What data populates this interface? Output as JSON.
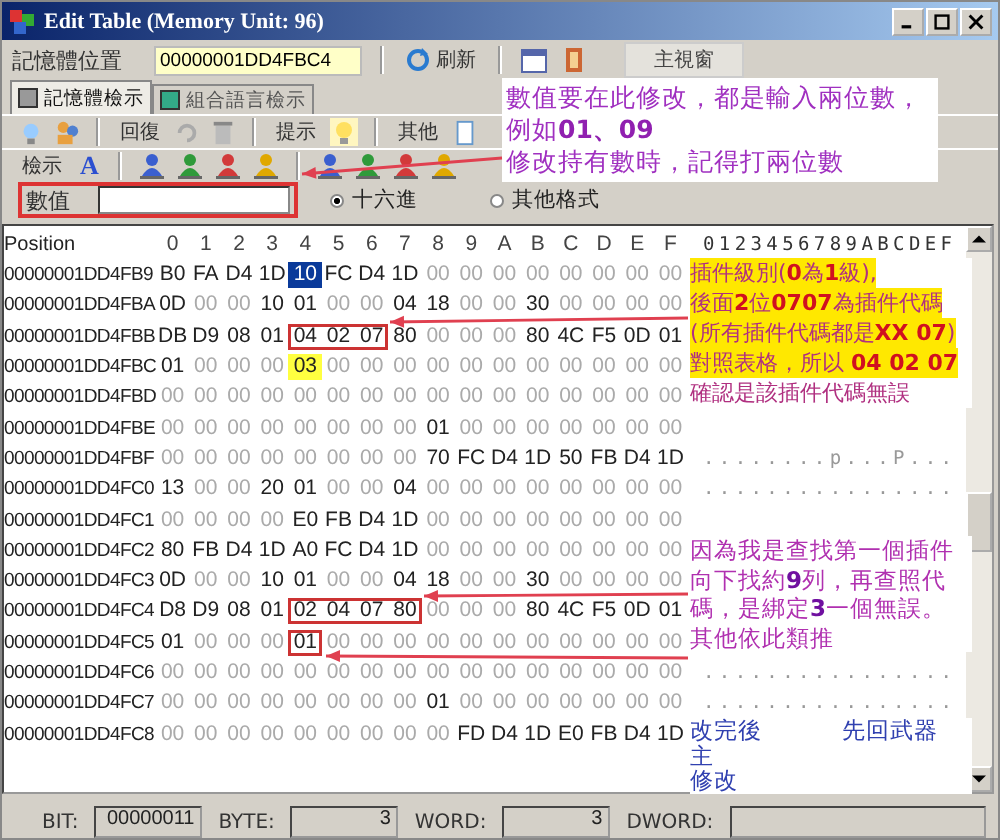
{
  "window": {
    "title": "Edit Table (Memory Unit: 96)"
  },
  "address_bar": {
    "label": "記憶體位置",
    "value": "00000001DD4FBC4",
    "refresh": "刷新",
    "main_window": "主視窗"
  },
  "tabs": [
    {
      "label": "記憶體檢示",
      "selected": true
    },
    {
      "label": "組合語言檢示",
      "selected": false
    }
  ],
  "toolbar": {
    "restore": "回復",
    "hint": "提示",
    "other": "其他",
    "view": "檢示",
    "font_glyph": "A"
  },
  "value_row": {
    "label": "數值",
    "format_options": [
      {
        "label": "十六進",
        "selected": true
      },
      {
        "label": "其他格式",
        "selected": false
      }
    ]
  },
  "grid": {
    "position_header": "Position",
    "columns": [
      "0",
      "1",
      "2",
      "3",
      "4",
      "5",
      "6",
      "7",
      "8",
      "9",
      "A",
      "B",
      "C",
      "D",
      "E",
      "F"
    ],
    "ascii_header": "0123456789ABCDEF",
    "rows": [
      {
        "position": "00000001DD4FB9",
        "segments": [
          {
            "kind": "plain",
            "values": [
              "B0",
              "FA",
              "D4",
              "1D"
            ]
          },
          {
            "kind": "selected",
            "values": [
              "10"
            ]
          },
          {
            "kind": "plain",
            "values": [
              "FC",
              "D4",
              "1D",
              "00",
              "00",
              "00",
              "00",
              "00",
              "00",
              "00",
              "00"
            ]
          }
        ]
      },
      {
        "position": "00000001DD4FBA",
        "segments": [
          {
            "kind": "plain",
            "values": [
              "0D",
              "00",
              "00",
              "10",
              "01",
              "00",
              "00",
              "04",
              "18",
              "00",
              "00",
              "30",
              "00",
              "00",
              "00",
              "00"
            ]
          }
        ]
      },
      {
        "position": "00000001DD4FBB",
        "segments": [
          {
            "kind": "plain",
            "values": [
              "DB",
              "D9",
              "08",
              "01"
            ]
          },
          {
            "kind": "boxed",
            "values": [
              "04",
              "02",
              "07"
            ]
          },
          {
            "kind": "plain",
            "values": [
              "80",
              "00",
              "00",
              "00",
              "80",
              "4C",
              "F5",
              "0D",
              "01"
            ]
          }
        ]
      },
      {
        "position": "00000001DD4FBC",
        "segments": [
          {
            "kind": "plain",
            "values": [
              "01",
              "00",
              "00",
              "00"
            ]
          },
          {
            "kind": "highlighted",
            "values": [
              "03"
            ]
          },
          {
            "kind": "plain",
            "values": [
              "00",
              "00",
              "00",
              "00",
              "00",
              "00",
              "00",
              "00",
              "00",
              "00",
              "00"
            ]
          }
        ]
      },
      {
        "position": "00000001DD4FBD",
        "segments": [
          {
            "kind": "plain",
            "values": [
              "00",
              "00",
              "00",
              "00",
              "00",
              "00",
              "00",
              "00",
              "00",
              "00",
              "00",
              "00",
              "00",
              "00",
              "00",
              "00"
            ]
          }
        ]
      },
      {
        "position": "00000001DD4FBE",
        "segments": [
          {
            "kind": "plain",
            "values": [
              "00",
              "00",
              "00",
              "00",
              "00",
              "00",
              "00",
              "00",
              "01",
              "00",
              "00",
              "00",
              "00",
              "00",
              "00",
              "00"
            ]
          }
        ]
      },
      {
        "position": "00000001DD4FBF",
        "segments": [
          {
            "kind": "plain",
            "values": [
              "00",
              "00",
              "00",
              "00",
              "00",
              "00",
              "00",
              "00",
              "70",
              "FC",
              "D4",
              "1D",
              "50",
              "FB",
              "D4",
              "1D"
            ]
          }
        ],
        "ascii": "........p...P..."
      },
      {
        "position": "00000001DD4FC0",
        "segments": [
          {
            "kind": "plain",
            "values": [
              "13",
              "00",
              "00",
              "20",
              "01",
              "00",
              "00",
              "04",
              "00",
              "00",
              "00",
              "00",
              "00",
              "00",
              "00",
              "00"
            ]
          }
        ],
        "ascii": "................"
      },
      {
        "position": "00000001DD4FC1",
        "segments": [
          {
            "kind": "plain",
            "values": [
              "00",
              "00",
              "00",
              "00",
              "E0",
              "FB",
              "D4",
              "1D",
              "00",
              "00",
              "00",
              "00",
              "00",
              "00",
              "00",
              "00"
            ]
          }
        ]
      },
      {
        "position": "00000001DD4FC2",
        "segments": [
          {
            "kind": "plain",
            "values": [
              "80",
              "FB",
              "D4",
              "1D",
              "A0",
              "FC",
              "D4",
              "1D",
              "00",
              "00",
              "00",
              "00",
              "00",
              "00",
              "00",
              "00"
            ]
          }
        ]
      },
      {
        "position": "00000001DD4FC3",
        "segments": [
          {
            "kind": "plain",
            "values": [
              "0D",
              "00",
              "00",
              "10",
              "01",
              "00",
              "00",
              "04",
              "18",
              "00",
              "00",
              "30",
              "00",
              "00",
              "00",
              "00"
            ]
          }
        ]
      },
      {
        "position": "00000001DD4FC4",
        "segments": [
          {
            "kind": "plain",
            "values": [
              "D8",
              "D9",
              "08",
              "01"
            ]
          },
          {
            "kind": "boxed",
            "values": [
              "02",
              "04",
              "07",
              "80"
            ]
          },
          {
            "kind": "plain",
            "values": [
              "00",
              "00",
              "00",
              "80",
              "4C",
              "F5",
              "0D",
              "01"
            ]
          }
        ]
      },
      {
        "position": "00000001DD4FC5",
        "segments": [
          {
            "kind": "plain",
            "values": [
              "01",
              "00",
              "00",
              "00"
            ]
          },
          {
            "kind": "boxed",
            "values": [
              "01"
            ]
          },
          {
            "kind": "plain",
            "values": [
              "00",
              "00",
              "00",
              "00",
              "00",
              "00",
              "00",
              "00",
              "00",
              "00",
              "00"
            ]
          }
        ]
      },
      {
        "position": "00000001DD4FC6",
        "segments": [
          {
            "kind": "plain",
            "values": [
              "00",
              "00",
              "00",
              "00",
              "00",
              "00",
              "00",
              "00",
              "00",
              "00",
              "00",
              "00",
              "00",
              "00",
              "00",
              "00"
            ]
          }
        ],
        "ascii": "................"
      },
      {
        "position": "00000001DD4FC7",
        "segments": [
          {
            "kind": "plain",
            "values": [
              "00",
              "00",
              "00",
              "00",
              "00",
              "00",
              "00",
              "00",
              "01",
              "00",
              "00",
              "00",
              "00",
              "00",
              "00",
              "00"
            ]
          }
        ],
        "ascii": "................"
      },
      {
        "position": "00000001DD4FC8",
        "segments": [
          {
            "kind": "plain",
            "values": [
              "00",
              "00",
              "00",
              "00",
              "00",
              "00",
              "00",
              "00",
              "00",
              "FD",
              "D4",
              "1D",
              "E0",
              "FB",
              "D4",
              "1D"
            ]
          }
        ]
      }
    ]
  },
  "status_bar": [
    {
      "label": "BIT:",
      "value": "00000011"
    },
    {
      "label": "BYTE:",
      "value": "3"
    },
    {
      "label": "WORD:",
      "value": "3"
    },
    {
      "label": "DWORD:"
    }
  ],
  "annotations": [
    {
      "lines": [
        {
          "text": "數值要在此修改，都是輸入兩位數，",
          "highlighted": false
        },
        {
          "text": "例如**01、09**",
          "highlighted": false
        },
        {
          "text": "修改持有數時，記得打兩位數",
          "highlighted": false
        }
      ]
    },
    {
      "lines": [
        {
          "text": "插件級別(**0**為**1**級),",
          "highlighted": true
        },
        {
          "text": "後面**2**位**0707**為插件代碼",
          "highlighted": true
        },
        {
          "text": "(所有插件代碼都是**XX 07**)",
          "highlighted": true
        },
        {
          "text": "對照表格，所以 **04 02 07**",
          "highlighted": true
        },
        {
          "text": "確認是該插件代碼無誤",
          "highlighted": false
        }
      ]
    },
    {
      "lines": [
        {
          "text": "因為我是查找第一個插件",
          "highlighted": false
        },
        {
          "text": "向下找約**9**列，再查照代",
          "highlighted": false
        },
        {
          "text": "碼，是綁定**3**一個無誤。",
          "highlighted": false
        },
        {
          "text": "其他依此類推",
          "highlighted": false
        }
      ]
    },
    {
      "lines": [
        {
          "text": "改完後",
          "trailing": "先回武器",
          "highlighted": false
        },
        {
          "text": "主",
          "highlighted": false
        },
        {
          "text": "修改",
          "highlighted": false
        }
      ]
    }
  ]
}
